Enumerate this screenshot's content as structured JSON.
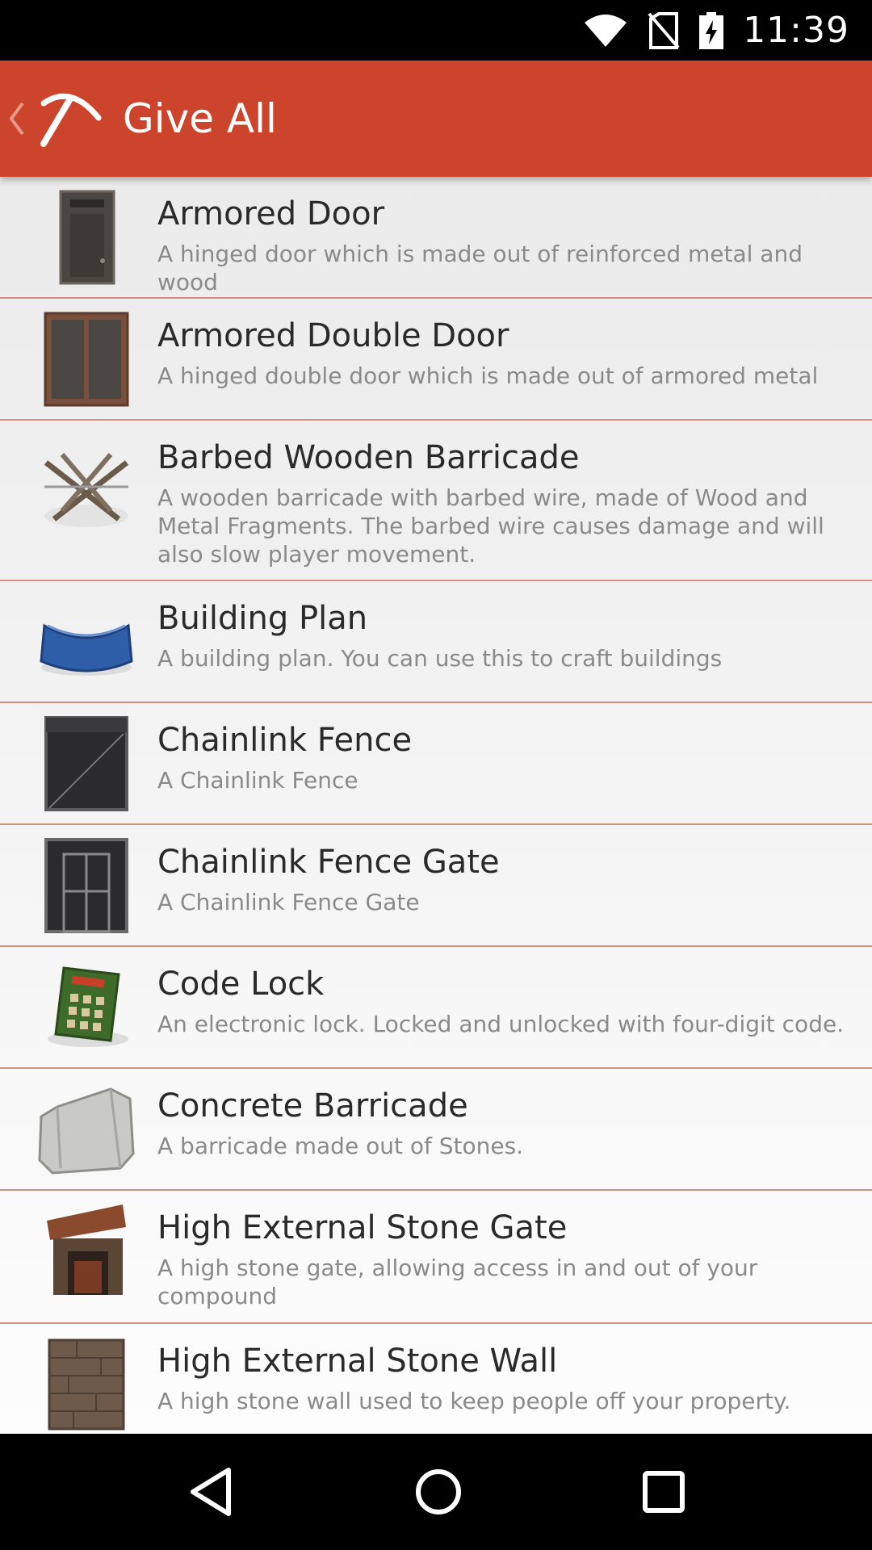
{
  "status_bar": {
    "time": "11:39",
    "icons": [
      "wifi-icon",
      "no-sim-icon",
      "battery-charging-icon"
    ]
  },
  "app_bar": {
    "title": "Give All",
    "back_icon": "chevron-left-icon",
    "logo_icon": "pickaxe-icon",
    "color": "#cc442c"
  },
  "items": [
    {
      "name": "Armored Door",
      "description": "A hinged door which is made out of reinforced metal and wood",
      "icon": "armored-door-icon"
    },
    {
      "name": "Armored Double Door",
      "description": "A hinged double door which is made out of armored metal",
      "icon": "armored-double-door-icon"
    },
    {
      "name": "Barbed Wooden Barricade",
      "description": "A wooden barricade with barbed wire, made of Wood and Metal Fragments. The barbed wire causes damage and will also slow player movement.",
      "icon": "barbed-barricade-icon"
    },
    {
      "name": "Building Plan",
      "description": "A building plan. You can use this to craft buildings",
      "icon": "building-plan-icon"
    },
    {
      "name": "Chainlink Fence",
      "description": "A Chainlink Fence",
      "icon": "chainlink-fence-icon"
    },
    {
      "name": "Chainlink Fence Gate",
      "description": "A Chainlink Fence Gate",
      "icon": "chainlink-fence-gate-icon"
    },
    {
      "name": "Code Lock",
      "description": "An electronic lock. Locked and unlocked with four-digit code.",
      "icon": "code-lock-icon"
    },
    {
      "name": "Concrete Barricade",
      "description": "A barricade made out of Stones.",
      "icon": "concrete-barricade-icon"
    },
    {
      "name": "High External Stone Gate",
      "description": "A high stone gate, allowing access in and out of your compound",
      "icon": "stone-gate-icon"
    },
    {
      "name": "High External Stone Wall",
      "description": "A high stone wall used to keep people off your property.",
      "icon": "stone-wall-icon"
    }
  ],
  "nav_bar": {
    "icons": [
      "back-triangle-icon",
      "home-circle-icon",
      "recents-square-icon"
    ]
  }
}
